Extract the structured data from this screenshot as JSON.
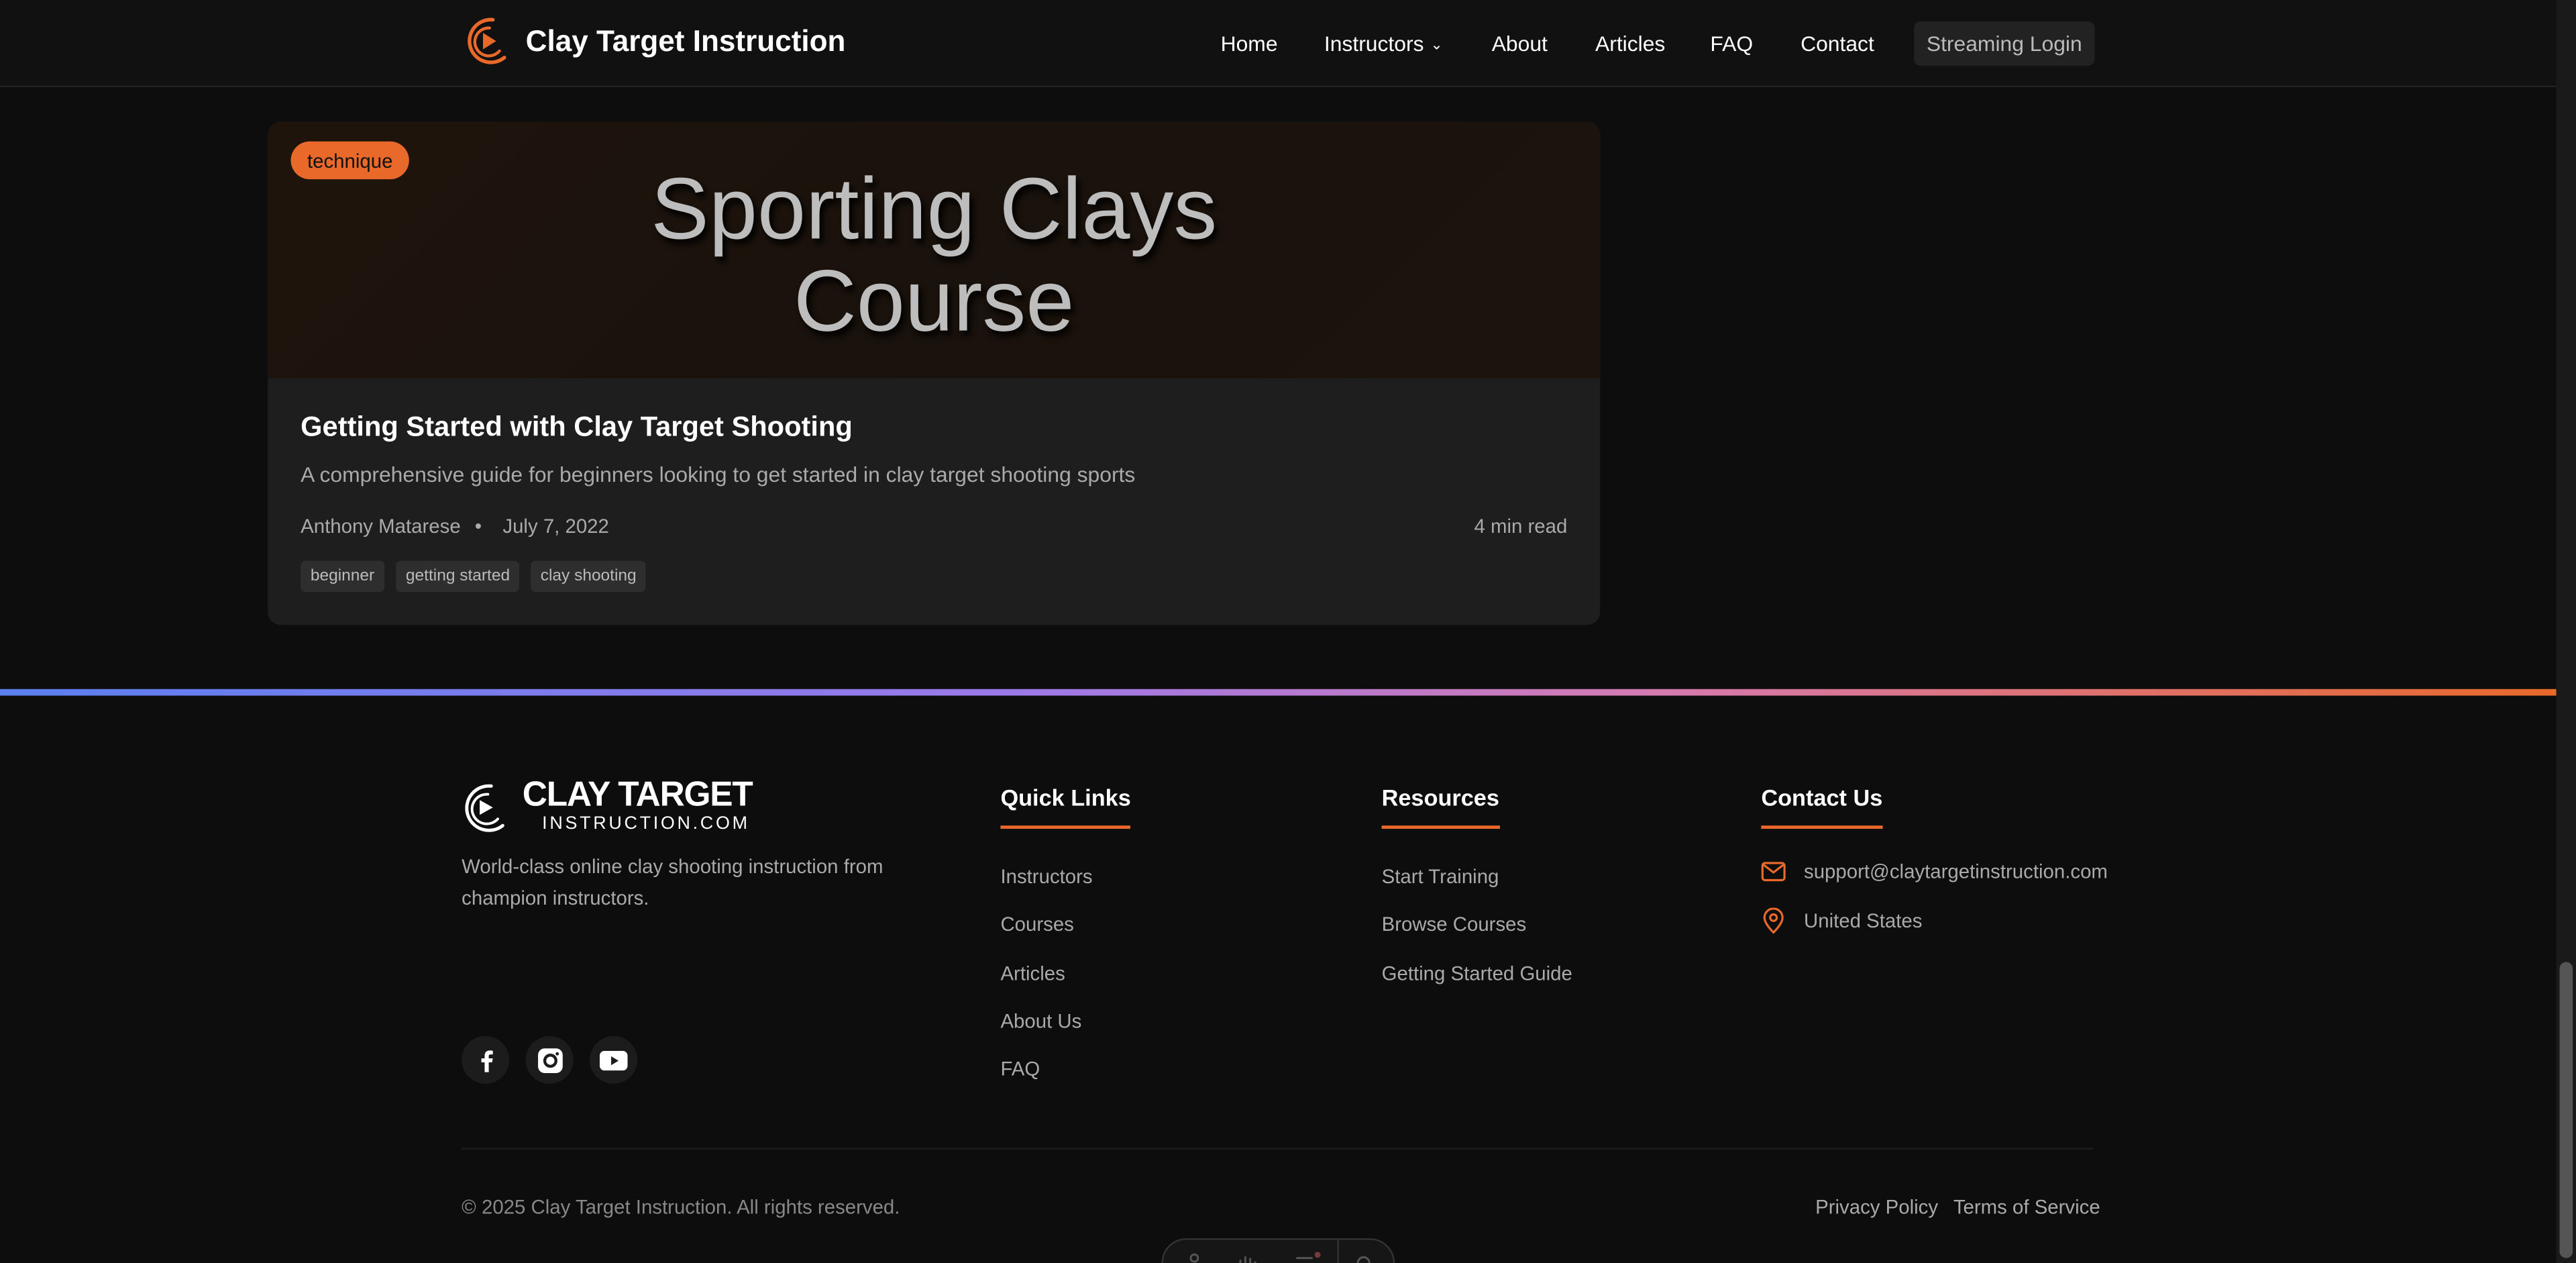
{
  "header": {
    "brand": "Clay Target Instruction",
    "nav": {
      "home": "Home",
      "instructors": "Instructors",
      "about": "About",
      "articles": "Articles",
      "faq": "FAQ",
      "contact": "Contact"
    },
    "streaming_login": "Streaming Login"
  },
  "article_card": {
    "category_badge": "technique",
    "image_text_line1": "Sporting Clays",
    "image_text_line2": "Course",
    "title": "Getting Started with Clay Target Shooting",
    "description": "A comprehensive guide for beginners looking to get started in clay target shooting sports",
    "author": "Anthony Matarese",
    "separator": "•",
    "date": "July 7, 2022",
    "read_time": "4 min read",
    "tags": [
      "beginner",
      "getting started",
      "clay shooting"
    ]
  },
  "footer": {
    "logo_main": "CLAY TARGET",
    "logo_sub": "INSTRUCTION.COM",
    "tagline": "World-class online clay shooting instruction from champion instructors.",
    "social": [
      "facebook-icon",
      "instagram-icon",
      "youtube-icon"
    ],
    "quick_links": {
      "heading": "Quick Links",
      "items": [
        "Instructors",
        "Courses",
        "Articles",
        "About Us",
        "FAQ"
      ]
    },
    "resources": {
      "heading": "Resources",
      "items": [
        "Start Training",
        "Browse Courses",
        "Getting Started Guide"
      ]
    },
    "contact": {
      "heading": "Contact Us",
      "email": "support@claytargetinstruction.com",
      "location": "United States"
    },
    "copyright": "© 2025 Clay Target Instruction. All rights reserved.",
    "privacy": "Privacy Policy",
    "terms": "Terms of Service"
  },
  "colors": {
    "accent": "#e8692a",
    "background": "#0d0d0d",
    "card": "#1e1e1e"
  }
}
